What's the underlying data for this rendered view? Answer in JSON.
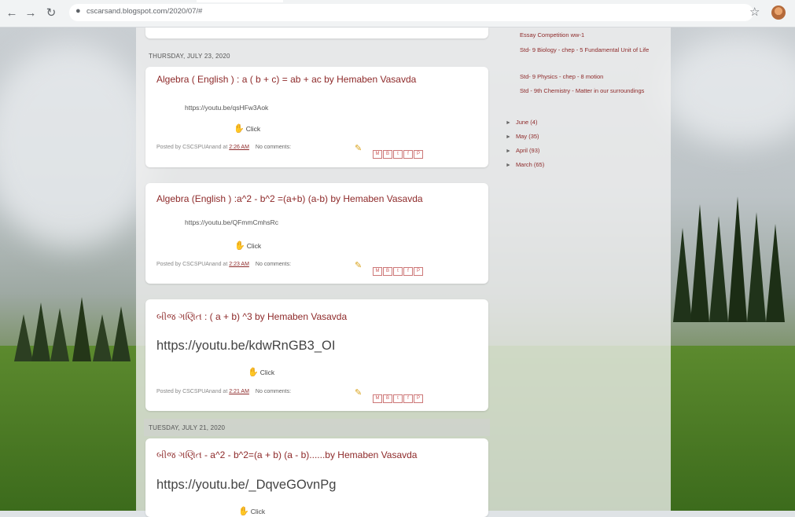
{
  "browser": {
    "url": "cscarsand.blogspot.com/2020/07/#",
    "icons": [
      "back-icon",
      "forward-icon",
      "reload-icon",
      "lock-icon",
      "star-icon",
      "avatar"
    ]
  },
  "dates": {
    "d1": "THURSDAY, JULY 23, 2020",
    "d2": "TUESDAY, JULY 21, 2020"
  },
  "posts": [
    {
      "title": "Algebra ( English ) : a ( b + c) = ab + ac by Hemaben Vasavda",
      "link": "https://youtu.be/qsHFw3Aok",
      "click": "Click",
      "posted": "Posted by CSCSPUAnand at",
      "time": "2:26 AM",
      "comments": "No comments:"
    },
    {
      "title": "Algebra (English ) :a^2 - b^2 =(a+b) (a-b) by Hemaben Vasavda",
      "link": "https://youtu.be/QFmmCmhsRc",
      "click": "Click",
      "posted": "Posted by CSCSPUAnand at",
      "time": "2:23 AM",
      "comments": "No comments:"
    },
    {
      "title": "બીજ ગણિત : ( a + b) ^3 by Hemaben Vasavda",
      "link": "https://youtu.be/kdwRnGB3_OI",
      "click": "Click",
      "posted": "Posted by CSCSPUAnand at",
      "time": "2:21 AM",
      "comments": "No comments:"
    },
    {
      "title": "બીજ ગણિત - a^2 - b^2=(a + b) (a - b)......by Hemaben Vasavda",
      "link": "https://youtu.be/_DqveGOvnPg",
      "click": "Click"
    }
  ],
  "sidebar": {
    "links": [
      "Essay Competition ww-1",
      "Std- 9 Biology - chep - 5 Fundamental Unit of Life",
      "Std- 9 Physics - chep - 8 motion",
      "Std - 9th Chemistry - Matter in our surroundings"
    ],
    "archive": [
      "June (4)",
      "May (35)",
      "April (93)",
      "March (65)"
    ]
  },
  "colors": {
    "title": "#8e2a2a",
    "column": "#f0f0f0"
  }
}
